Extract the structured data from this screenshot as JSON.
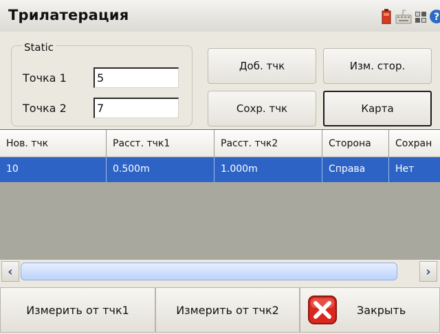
{
  "window": {
    "title": "Трилатерация"
  },
  "tray_icons": [
    "battery-icon",
    "keyboard-icon",
    "apps-icon",
    "help-icon"
  ],
  "static_group": {
    "label": "Static",
    "point1_label": "Точка 1",
    "point1_value": "5",
    "point2_label": "Точка 2",
    "point2_value": "7"
  },
  "buttons": {
    "add_point": "Доб. тчк",
    "change_side": "Изм. стор.",
    "save_point": "Сохр. тчк",
    "map": "Карта"
  },
  "table": {
    "columns": [
      "Нов. тчк",
      "Расст. тчк1",
      "Расст. тчк2",
      "Сторона",
      "Сохран"
    ],
    "rows": [
      [
        "10",
        "0.500m",
        "1.000m",
        "Справа",
        "Нет"
      ]
    ]
  },
  "bottom": {
    "measure1": "Измерить от тчк1",
    "measure2": "Измерить от тчк2",
    "close": "Закрыть"
  },
  "colors": {
    "selection": "#2e63c6",
    "close_icon_red": "#d9281f"
  }
}
